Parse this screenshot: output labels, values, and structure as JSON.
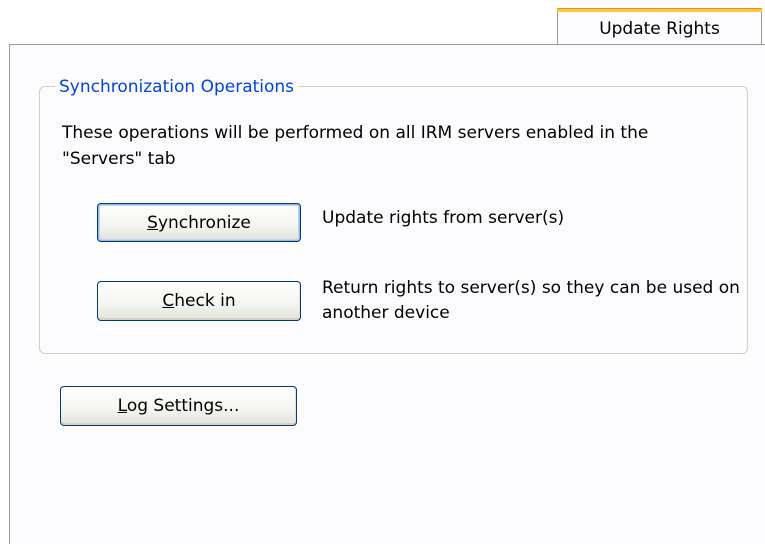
{
  "tab": {
    "label": "Update Rights"
  },
  "group": {
    "title": "Synchronization Operations",
    "description": "These operations will be performed on all IRM servers enabled in the \"Servers\" tab"
  },
  "synchronize": {
    "button_label": "Synchronize",
    "description": "Update rights from server(s)"
  },
  "check_in": {
    "button_label": "Check in",
    "description": "Return rights to server(s) so they can be used on another device"
  },
  "log_settings": {
    "button_label": "Log Settings..."
  }
}
